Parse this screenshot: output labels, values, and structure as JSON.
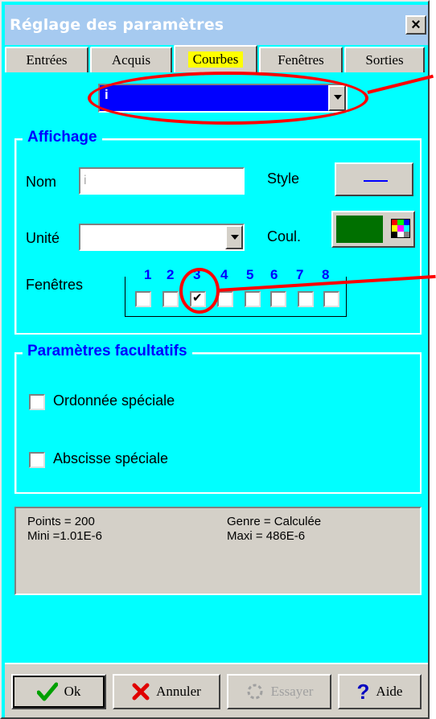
{
  "window": {
    "title": "Réglage des paramètres",
    "close_label": "×"
  },
  "tabs": [
    {
      "label": "Entrées",
      "active": false
    },
    {
      "label": "Acquis",
      "active": false
    },
    {
      "label": "Courbes",
      "active": true
    },
    {
      "label": "Fenêtres",
      "active": false
    },
    {
      "label": "Sorties",
      "active": false
    }
  ],
  "curve_select": {
    "value": "i"
  },
  "affichage": {
    "title": "Affichage",
    "nom_label": "Nom",
    "nom_value": "i",
    "style_label": "Style",
    "unite_label": "Unité",
    "unite_value": "",
    "coul_label": "Coul.",
    "coul_color": "#007000",
    "fenetres_label": "Fenêtres",
    "windows": [
      {
        "num": "1",
        "checked": false
      },
      {
        "num": "2",
        "checked": false
      },
      {
        "num": "3",
        "checked": true
      },
      {
        "num": "4",
        "checked": false
      },
      {
        "num": "5",
        "checked": false
      },
      {
        "num": "6",
        "checked": false
      },
      {
        "num": "7",
        "checked": false
      },
      {
        "num": "8",
        "checked": false
      }
    ]
  },
  "facultatifs": {
    "title": "Paramètres facultatifs",
    "ordonnee_label": "Ordonnée spéciale",
    "ordonnee_checked": false,
    "abscisse_label": "Abscisse spéciale",
    "abscisse_checked": false
  },
  "info": {
    "points": "Points = 200",
    "genre": "Genre = Calculée",
    "mini": "Mini =1.01E-6",
    "maxi": "Maxi = 486E-6"
  },
  "buttons": {
    "ok": "Ok",
    "annuler": "Annuler",
    "essayer": "Essayer",
    "aide": "Aide"
  },
  "colors": {
    "background": "#00ffff",
    "accent": "#0000ff",
    "annotation": "#ff0000",
    "titlebar": "#a6caf0"
  }
}
